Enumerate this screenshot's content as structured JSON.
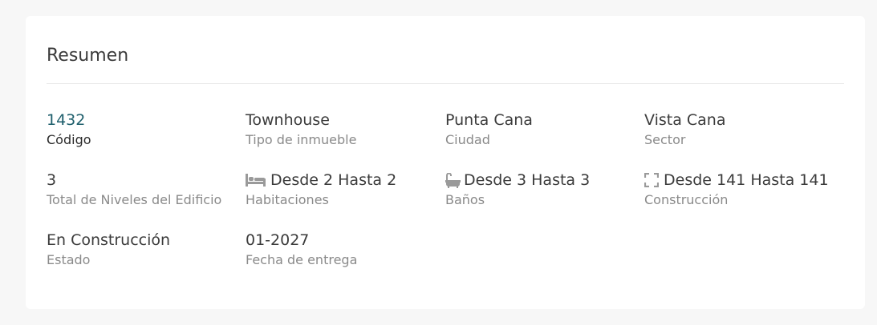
{
  "summary": {
    "title": "Resumen",
    "code": {
      "value": "1432",
      "label": "Código"
    },
    "property_type": {
      "value": "Townhouse",
      "label": "Tipo de inmueble"
    },
    "city": {
      "value": "Punta Cana",
      "label": "Ciudad"
    },
    "sector": {
      "value": "Vista Cana",
      "label": "Sector"
    },
    "levels": {
      "value": "3",
      "label": "Total de Niveles del Edificio"
    },
    "bedrooms": {
      "value": "Desde 2 Hasta 2",
      "label": "Habitaciones",
      "icon": "bed-icon"
    },
    "bathrooms": {
      "value": "Desde 3 Hasta 3",
      "label": "Baños",
      "icon": "bathtub-icon"
    },
    "construction": {
      "value": "Desde 141 Hasta 141",
      "label": "Construcción",
      "icon": "area-icon"
    },
    "status": {
      "value": "En Construcción",
      "label": "Estado"
    },
    "delivery_date": {
      "value": "01-2027",
      "label": "Fecha de entrega"
    }
  }
}
